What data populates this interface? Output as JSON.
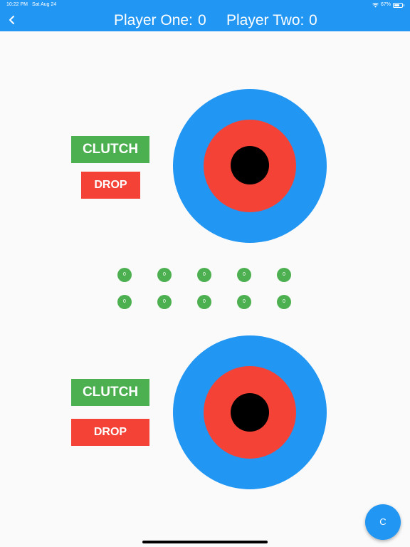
{
  "status_bar": {
    "time": "10:22 PM",
    "date": "Sat Aug 24",
    "battery": "67%"
  },
  "app_bar": {
    "back_icon": "chevron-left-icon",
    "player_one_label": "Player One:",
    "player_one_score": "0",
    "player_two_label": "Player Two:",
    "player_two_score": "0"
  },
  "player_one_controls": {
    "clutch_label": "CLUTCH",
    "drop_label": "DROP"
  },
  "player_two_controls": {
    "clutch_label": "CLUTCH",
    "drop_label": "DROP"
  },
  "counters": {
    "row1": [
      "0",
      "0",
      "0",
      "0",
      "0"
    ],
    "row2": [
      "0",
      "0",
      "0",
      "0",
      "0"
    ]
  },
  "fab": {
    "label": "C"
  },
  "colors": {
    "primary_blue": "#2196f3",
    "green": "#4caf50",
    "red": "#f44336",
    "black": "#000000",
    "background": "#fafafa"
  }
}
